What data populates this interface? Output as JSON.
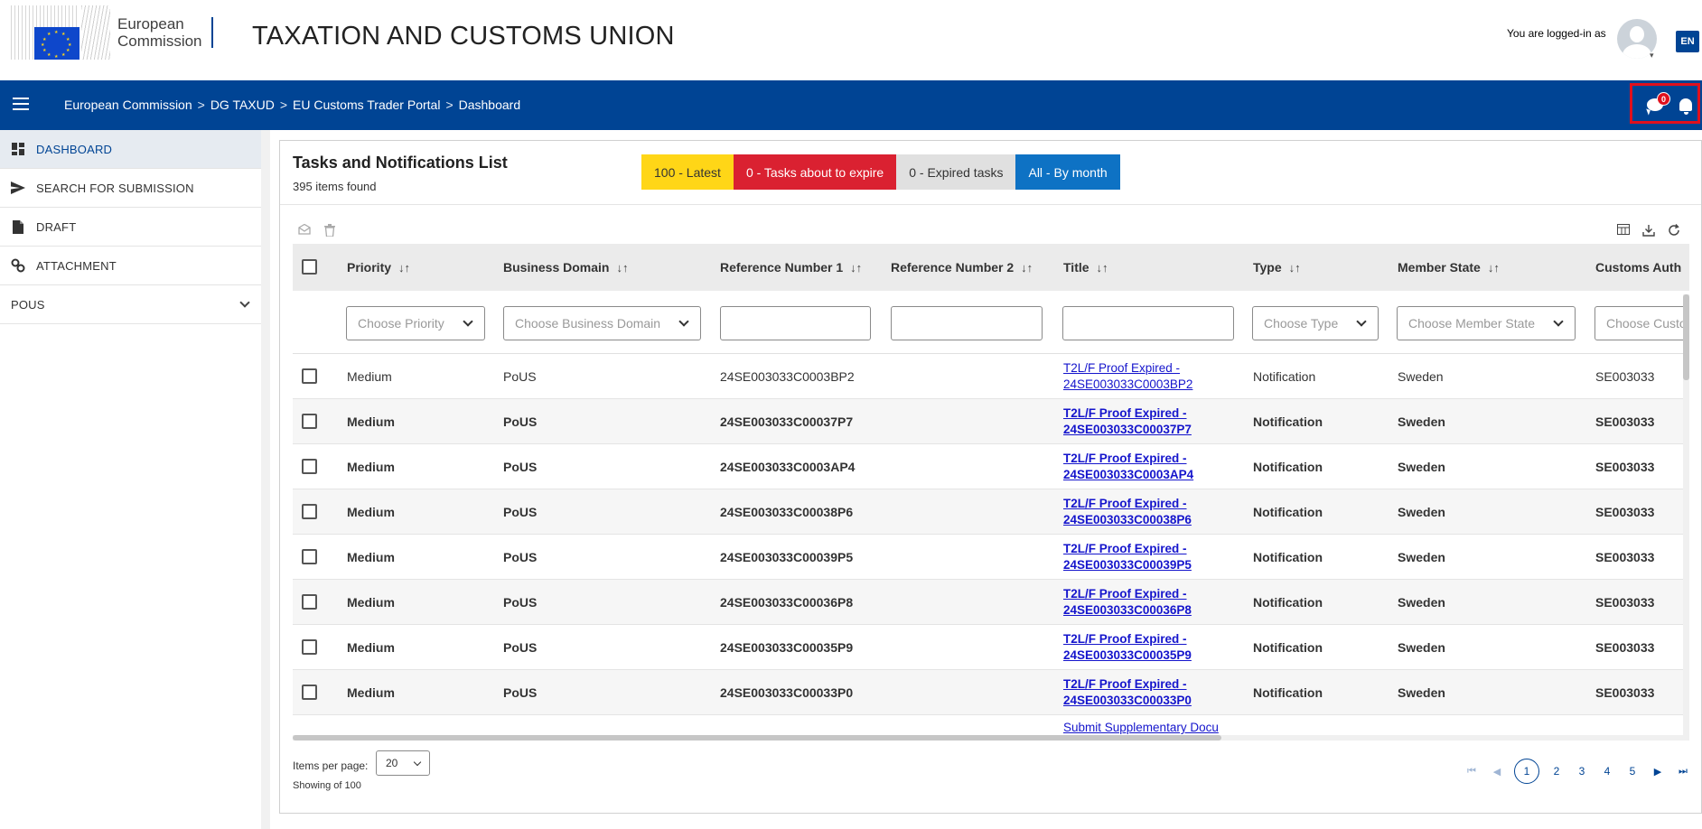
{
  "header": {
    "org_line1": "European",
    "org_line2": "Commission",
    "site_title": "TAXATION AND CUSTOMS UNION",
    "logged_in_text": "You are logged-in as",
    "language": "EN"
  },
  "nav": {
    "breadcrumbs": [
      "European Commission",
      "DG TAXUD",
      "EU Customs Trader Portal",
      "Dashboard"
    ],
    "breadcrumb_sep": ">",
    "message_count": "0"
  },
  "sidebar": {
    "items": [
      {
        "label": "DASHBOARD",
        "icon": "dashboard-icon"
      },
      {
        "label": "SEARCH FOR SUBMISSION",
        "icon": "send-icon"
      },
      {
        "label": "DRAFT",
        "icon": "document-icon"
      },
      {
        "label": "ATTACHMENT",
        "icon": "link-icon"
      },
      {
        "label": "POUS",
        "icon": "chevron-down-icon"
      }
    ]
  },
  "panel": {
    "title": "Tasks and Notifications List",
    "count": "395 items found",
    "filters": [
      "100 - Latest",
      "0 - Tasks about to expire",
      "0 - Expired tasks",
      "All - By month"
    ]
  },
  "table": {
    "columns": [
      "Priority",
      "Business Domain",
      "Reference Number 1",
      "Reference Number 2",
      "Title",
      "Type",
      "Member State",
      "Customs Auth"
    ],
    "filter_placeholders": {
      "priority": "Choose Priority",
      "domain": "Choose Business Domain",
      "type": "Choose Type",
      "member_state": "Choose Member State",
      "customs": "Choose Custo"
    },
    "rows": [
      {
        "priority": "Medium",
        "domain": "PoUS",
        "ref1": "24SE003033C0003BP2",
        "ref2": "",
        "title": "T2L/F Proof Expired - 24SE003033C0003BP2",
        "type": "Notification",
        "state": "Sweden",
        "customs": "SE003033"
      },
      {
        "priority": "Medium",
        "domain": "PoUS",
        "ref1": "24SE003033C00037P7",
        "ref2": "",
        "title": "T2L/F Proof Expired - 24SE003033C00037P7",
        "type": "Notification",
        "state": "Sweden",
        "customs": "SE003033"
      },
      {
        "priority": "Medium",
        "domain": "PoUS",
        "ref1": "24SE003033C0003AP4",
        "ref2": "",
        "title": "T2L/F Proof Expired - 24SE003033C0003AP4",
        "type": "Notification",
        "state": "Sweden",
        "customs": "SE003033"
      },
      {
        "priority": "Medium",
        "domain": "PoUS",
        "ref1": "24SE003033C00038P6",
        "ref2": "",
        "title": "T2L/F Proof Expired - 24SE003033C00038P6",
        "type": "Notification",
        "state": "Sweden",
        "customs": "SE003033"
      },
      {
        "priority": "Medium",
        "domain": "PoUS",
        "ref1": "24SE003033C00039P5",
        "ref2": "",
        "title": "T2L/F Proof Expired - 24SE003033C00039P5",
        "type": "Notification",
        "state": "Sweden",
        "customs": "SE003033"
      },
      {
        "priority": "Medium",
        "domain": "PoUS",
        "ref1": "24SE003033C00036P8",
        "ref2": "",
        "title": "T2L/F Proof Expired - 24SE003033C00036P8",
        "type": "Notification",
        "state": "Sweden",
        "customs": "SE003033"
      },
      {
        "priority": "Medium",
        "domain": "PoUS",
        "ref1": "24SE003033C00035P9",
        "ref2": "",
        "title": "T2L/F Proof Expired - 24SE003033C00035P9",
        "type": "Notification",
        "state": "Sweden",
        "customs": "SE003033"
      },
      {
        "priority": "Medium",
        "domain": "PoUS",
        "ref1": "24SE003033C00033P0",
        "ref2": "",
        "title": "T2L/F Proof Expired - 24SE003033C00033P0",
        "type": "Notification",
        "state": "Sweden",
        "customs": "SE003033"
      },
      {
        "priority": "",
        "domain": "",
        "ref1": "",
        "ref2": "",
        "title": "Submit Supplementary Docu",
        "type": "",
        "state": "",
        "customs": ""
      }
    ]
  },
  "footer": {
    "items_per_page_label": "Items per page:",
    "items_per_page_value": "20",
    "showing": "Showing of 100",
    "pages": [
      "1",
      "2",
      "3",
      "4",
      "5"
    ],
    "current_page": "1"
  },
  "colors": {
    "brand_blue": "#004494",
    "latest": "#ffd617",
    "expire": "#da2131",
    "expired": "#e0e0e0",
    "all": "#0e72c4",
    "link": "#1515cc",
    "highlight_box": "#e0101d"
  }
}
